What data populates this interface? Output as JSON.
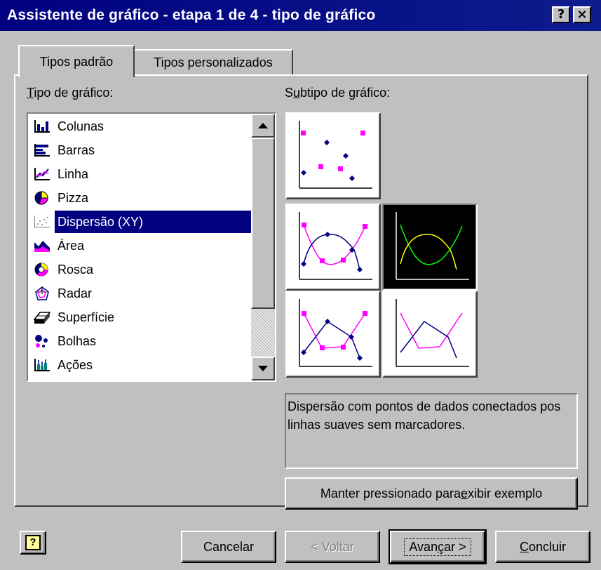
{
  "window": {
    "title": "Assistente de gráfico - etapa 1 de 4 - tipo de gráfico",
    "help_glyph": "?",
    "close_glyph": "×"
  },
  "tabs": [
    {
      "label": "Tipos padrão",
      "active": true
    },
    {
      "label": "Tipos personalizados",
      "active": false
    }
  ],
  "chart_type_label": {
    "u": "T",
    "rest": "ipo de gráfico:"
  },
  "subtype_label": {
    "pre": "S",
    "u": "u",
    "rest": "btipo de gráfico:"
  },
  "chart_types": [
    {
      "label": "Colunas",
      "icon": "column-chart-icon"
    },
    {
      "label": "Barras",
      "icon": "bar-chart-icon"
    },
    {
      "label": "Linha",
      "icon": "line-chart-icon"
    },
    {
      "label": "Pizza",
      "icon": "pie-chart-icon"
    },
    {
      "label": "Dispersão (XY)",
      "icon": "scatter-chart-icon",
      "selected": true
    },
    {
      "label": "Área",
      "icon": "area-chart-icon"
    },
    {
      "label": "Rosca",
      "icon": "doughnut-chart-icon"
    },
    {
      "label": "Radar",
      "icon": "radar-chart-icon"
    },
    {
      "label": "Superfície",
      "icon": "surface-chart-icon"
    },
    {
      "label": "Bolhas",
      "icon": "bubble-chart-icon"
    },
    {
      "label": "Ações",
      "icon": "stock-chart-icon"
    }
  ],
  "subtypes": [
    {
      "name": "scatter-markers-only"
    },
    {
      "name": "scatter-smooth-lines-markers"
    },
    {
      "name": "scatter-smooth-lines-no-markers",
      "selected": true
    },
    {
      "name": "scatter-straight-lines-markers"
    },
    {
      "name": "scatter-straight-lines-no-markers"
    }
  ],
  "description": "Dispersão com pontos de dados conectados pos linhas suaves sem marcadores.",
  "preview_button": {
    "pre": "Manter pressionado para ",
    "u": "e",
    "rest": "xibir exemplo"
  },
  "buttons": {
    "help_glyph": "?",
    "cancel": "Cancelar",
    "back": "< Voltar",
    "next": {
      "pre": "Avan",
      "u": "ç",
      "rest": "ar >"
    },
    "finish": {
      "u": "C",
      "rest": "oncluir"
    }
  },
  "colors": {
    "titlebar": "#000080",
    "selection": "#000080",
    "series_a": "#ff00ff",
    "series_b": "#000080",
    "selected_series_a": "#ffff00",
    "selected_series_b": "#00ff00"
  }
}
